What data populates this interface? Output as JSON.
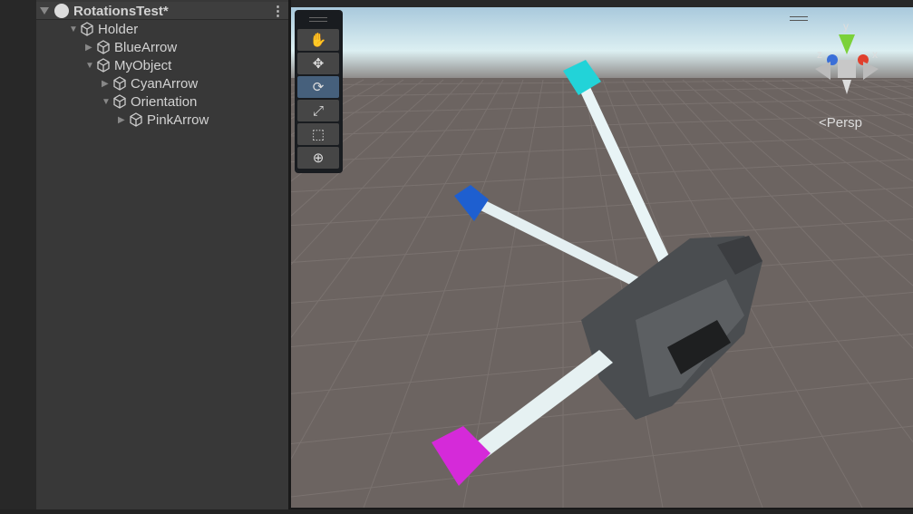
{
  "hierarchy": {
    "scene_title": "RotationsTest*",
    "items": [
      {
        "label": "Holder",
        "expanded": true,
        "depth": 0
      },
      {
        "label": "BlueArrow",
        "expanded": false,
        "depth": 1
      },
      {
        "label": "MyObject",
        "expanded": true,
        "depth": 1
      },
      {
        "label": "CyanArrow",
        "expanded": false,
        "depth": 2
      },
      {
        "label": "Orientation",
        "expanded": true,
        "depth": 2
      },
      {
        "label": "PinkArrow",
        "expanded": false,
        "depth": 3
      }
    ]
  },
  "scene": {
    "tools": [
      {
        "name": "hand",
        "glyph": "✋",
        "active": false
      },
      {
        "name": "move",
        "glyph": "✥",
        "active": false
      },
      {
        "name": "rotate",
        "glyph": "⟳",
        "active": true
      },
      {
        "name": "scale",
        "glyph": "⤢",
        "active": false
      },
      {
        "name": "rect",
        "glyph": "⬚",
        "active": false
      },
      {
        "name": "transform",
        "glyph": "⊕",
        "active": false
      }
    ],
    "gizmo": {
      "x": "x",
      "y": "y",
      "z": "z"
    },
    "projection": "<Persp",
    "colors": {
      "cyan": "#22d3d8",
      "blue": "#1e5fd0",
      "pink": "#d52ad9",
      "sky": "#dcecf0",
      "ground": "#6c6461"
    }
  }
}
